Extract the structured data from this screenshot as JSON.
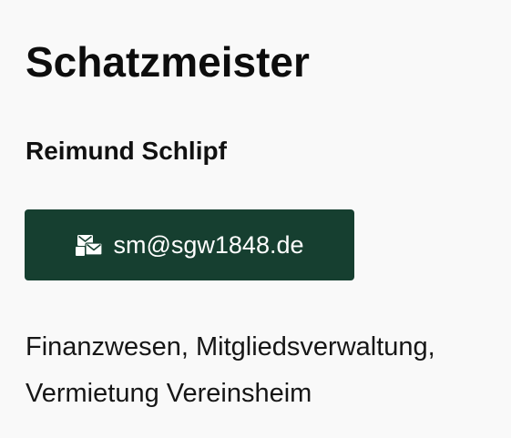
{
  "contact": {
    "role": "Schatzmeister",
    "name": "Reimund Schlipf",
    "email": "sm@sgw1848.de",
    "email_icon": "mail-envelopes-icon",
    "description": "Finanzwesen, Mitgliedsverwaltung, Vermietung Vereinsheim"
  },
  "colors": {
    "button_background": "#163f30",
    "button_text": "#ffffff",
    "page_background": "#f9f9f9"
  }
}
